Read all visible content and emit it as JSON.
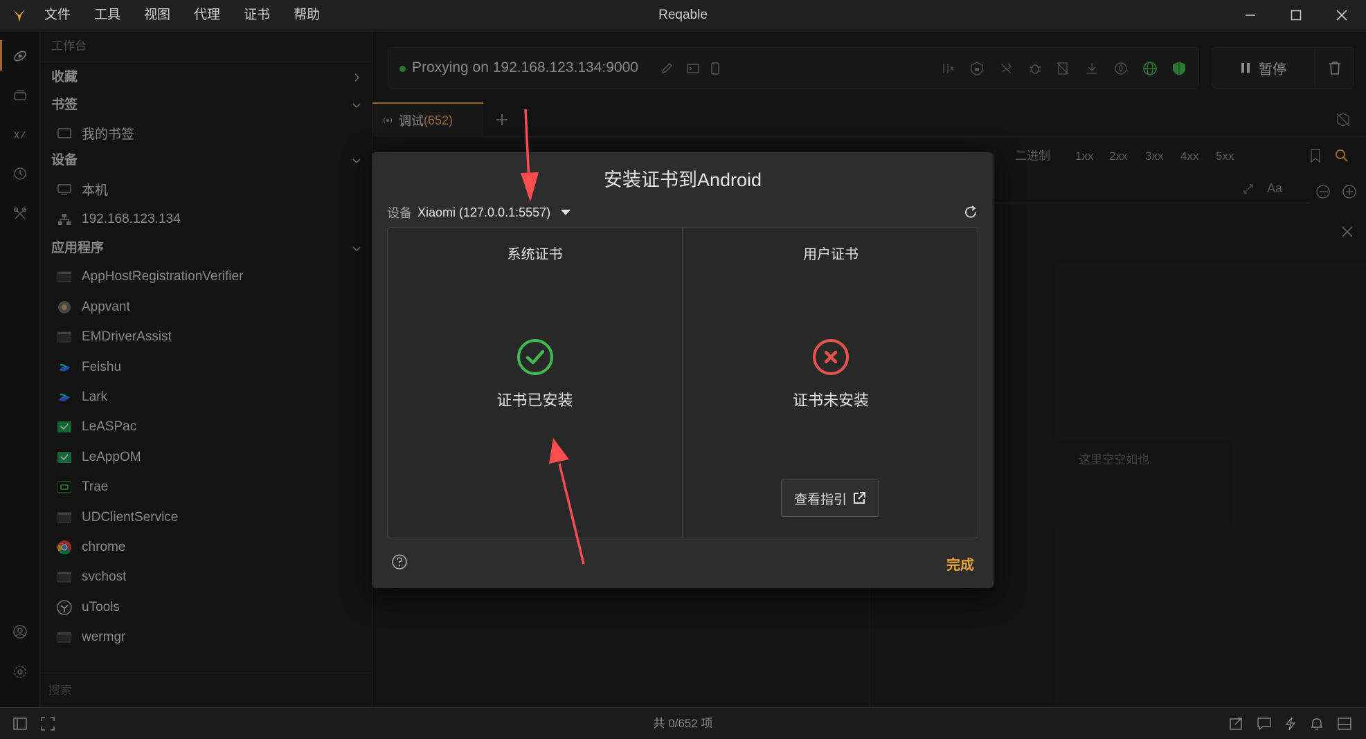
{
  "app": {
    "title": "Reqable",
    "menu": [
      "文件",
      "工具",
      "视图",
      "代理",
      "证书",
      "帮助"
    ]
  },
  "sidebar": {
    "header": "工作台",
    "sections": {
      "favorites": "收藏",
      "bookmarks": "书签",
      "devices": "设备",
      "apps": "应用程序"
    },
    "bookmark_item": "我的书签",
    "devices": [
      "本机",
      "192.168.123.134"
    ],
    "apps": [
      "AppHostRegistrationVerifier",
      "Appvant",
      "EMDriverAssist",
      "Feishu",
      "Lark",
      "LeASPac",
      "LeAppOM",
      "Trae",
      "UDClientService",
      "chrome",
      "svchost",
      "uTools",
      "wermgr"
    ],
    "search_placeholder": "搜索"
  },
  "proxy": {
    "status_text": "Proxying on 192.168.123.134:9000",
    "pause_label": "暂停"
  },
  "tabs": [
    {
      "label": "调试",
      "count": "(652)"
    }
  ],
  "filters": [
    "二进制",
    "1xx",
    "2xx",
    "3xx",
    "4xx",
    "5xx"
  ],
  "search_case_label": "Aa",
  "empty_text": "这里空空如也",
  "status_bar": {
    "count_text": "共 0/652 项"
  },
  "dialog": {
    "title": "安装证书到Android",
    "device_label": "设备",
    "device_value": "Xiaomi (127.0.0.1:5557)",
    "system_cert": {
      "title": "系统证书",
      "status": "证书已安装"
    },
    "user_cert": {
      "title": "用户证书",
      "status": "证书未安装",
      "guide_label": "查看指引"
    },
    "done_label": "完成"
  },
  "colors": {
    "accent": "#e8a33d",
    "success": "#3fb950",
    "error": "#e5534b",
    "annotation_arrow": "#ff4d4f"
  }
}
